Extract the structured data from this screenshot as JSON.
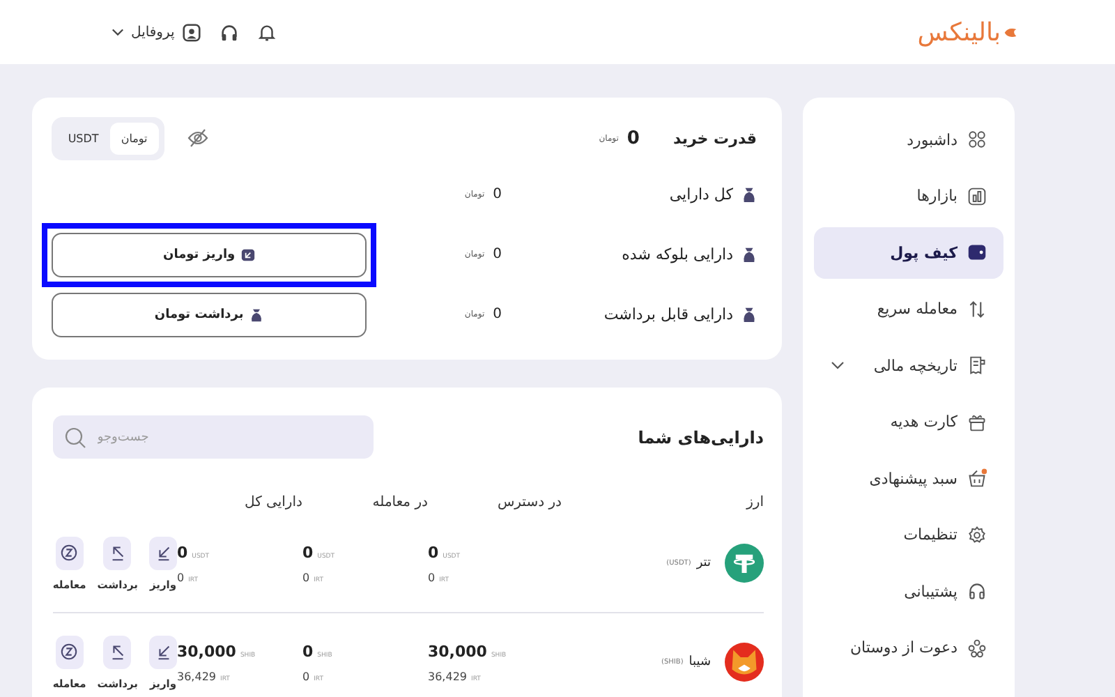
{
  "header": {
    "logo": "بالینکس",
    "profile": "پروفایل"
  },
  "sidebar": {
    "items": [
      {
        "label": "داشبورد",
        "kind": "grid",
        "selected": false,
        "has_submenu": false,
        "notification": false
      },
      {
        "label": "بازارها",
        "kind": "chart",
        "selected": false,
        "has_submenu": false,
        "notification": false
      },
      {
        "label": "کیف پول",
        "kind": "wallet",
        "selected": true,
        "has_submenu": false,
        "notification": false
      },
      {
        "label": "معامله سریع",
        "kind": "swap",
        "selected": false,
        "has_submenu": false,
        "notification": false
      },
      {
        "label": "تاریخچه مالی",
        "kind": "receipt",
        "selected": false,
        "has_submenu": true,
        "notification": false
      },
      {
        "label": "کارت هدیه",
        "kind": "gift",
        "selected": false,
        "has_submenu": false,
        "notification": false
      },
      {
        "label": "سبد پیشنهادی",
        "kind": "basket",
        "selected": false,
        "has_submenu": false,
        "notification": true
      },
      {
        "label": "تنظیمات",
        "kind": "gear",
        "selected": false,
        "has_submenu": false,
        "notification": false
      },
      {
        "label": "پشتیبانی",
        "kind": "headset",
        "selected": false,
        "has_submenu": false,
        "notification": false
      },
      {
        "label": "دعوت از دوستان",
        "kind": "people",
        "selected": false,
        "has_submenu": false,
        "notification": false
      }
    ]
  },
  "summary": {
    "purchase_power": {
      "label": "قدرت خرید",
      "value": "0",
      "unit": "تومان"
    },
    "currency_toggle": [
      {
        "label": "تومان",
        "selected": true
      },
      {
        "label": "USDT",
        "selected": false
      }
    ],
    "rows": [
      {
        "label": "کل دارایی",
        "value": "0",
        "unit": "تومان"
      },
      {
        "label": "دارایی بلوکه شده",
        "value": "0",
        "unit": "تومان",
        "button": {
          "label": "واریز تومان",
          "kind": "deposit",
          "highlighted": true
        }
      },
      {
        "label": "دارایی قابل برداشت",
        "value": "0",
        "unit": "تومان",
        "button": {
          "label": "برداشت تومان",
          "kind": "withdraw",
          "highlighted": false
        }
      }
    ]
  },
  "assets": {
    "title": "دارایی‌های شما",
    "search": {
      "placeholder": "جست‌وجو"
    },
    "columns": [
      "ارز",
      "در دسترس",
      "در معامله",
      "دارایی کل"
    ],
    "rows": [
      {
        "name": "تتر",
        "symbol": "(USDT)",
        "kind": "tether",
        "cells": [
          {
            "amount": "0",
            "unit": "USDT",
            "irt": "0",
            "irt_unit": "IRT"
          },
          {
            "amount": "0",
            "unit": "USDT",
            "irt": "0",
            "irt_unit": "IRT"
          },
          {
            "amount": "0",
            "unit": "USDT",
            "irt": "0",
            "irt_unit": "IRT"
          }
        ],
        "actions": [
          {
            "label": "واریز",
            "kind": "deposit"
          },
          {
            "label": "برداشت",
            "kind": "withdraw"
          },
          {
            "label": "معامله",
            "kind": "trade"
          }
        ]
      },
      {
        "name": "شیبا",
        "symbol": "(SHIB)",
        "kind": "shiba",
        "cells": [
          {
            "amount": "30,000",
            "unit": "SHIB",
            "irt": "36,429",
            "irt_unit": "IRT"
          },
          {
            "amount": "0",
            "unit": "SHIB",
            "irt": "0",
            "irt_unit": "IRT"
          },
          {
            "amount": "30,000",
            "unit": "SHIB",
            "irt": "36,429",
            "irt_unit": "IRT"
          }
        ],
        "actions": [
          {
            "label": "واریز",
            "kind": "deposit"
          },
          {
            "label": "برداشت",
            "kind": "withdraw"
          },
          {
            "label": "معامله",
            "kind": "trade"
          }
        ]
      }
    ]
  }
}
